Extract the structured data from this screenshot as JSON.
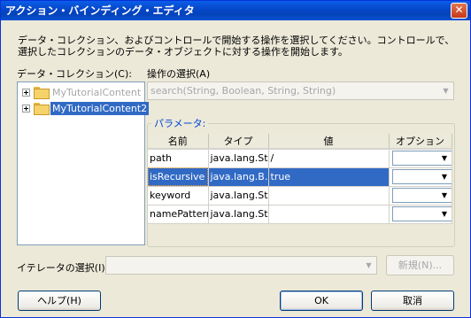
{
  "window": {
    "title": "アクション・バインディング・エディタ",
    "close_glyph": "✕"
  },
  "description": "データ・コレクション、およびコントロールで開始する操作を選択してください。コントロールで、選択したコレクションのデータ・オブジェクトに対する操作を開始します。",
  "data_collection": {
    "label": "データ・コレクション(C):",
    "items": [
      {
        "label": "MyTutorialContent",
        "selected": false
      },
      {
        "label": "MyTutorialContent2",
        "selected": true
      }
    ]
  },
  "operation": {
    "label": "操作の選択(A)",
    "value": "search(String, Boolean, String, String)"
  },
  "parameters": {
    "title": "パラメータ:",
    "columns": [
      "名前",
      "タイプ",
      "値",
      "オプション"
    ],
    "rows": [
      {
        "name": "path",
        "type": "java.lang.St...",
        "value": "/",
        "selected": false
      },
      {
        "name": "isRecursive",
        "type": "java.lang.B...",
        "value": "true",
        "selected": true
      },
      {
        "name": "keyword",
        "type": "java.lang.St...",
        "value": "",
        "selected": false
      },
      {
        "name": "namePattern",
        "type": "java.lang.St...",
        "value": "",
        "selected": false
      }
    ]
  },
  "iterator": {
    "label": "イテレータの選択(I):",
    "value": "",
    "new_button": "新規(N)..."
  },
  "buttons": {
    "help": "ヘルプ(H)",
    "ok": "OK",
    "cancel": "取消"
  },
  "icons": {
    "expand": "plus-expander-icon",
    "folder": "folder-icon",
    "dropdown": "chevron-down-icon",
    "dropdown_glyph": "▼"
  },
  "colors": {
    "selection": "#316ac5",
    "titlebar": "#0a5ee8",
    "group_title": "#0046d5"
  }
}
